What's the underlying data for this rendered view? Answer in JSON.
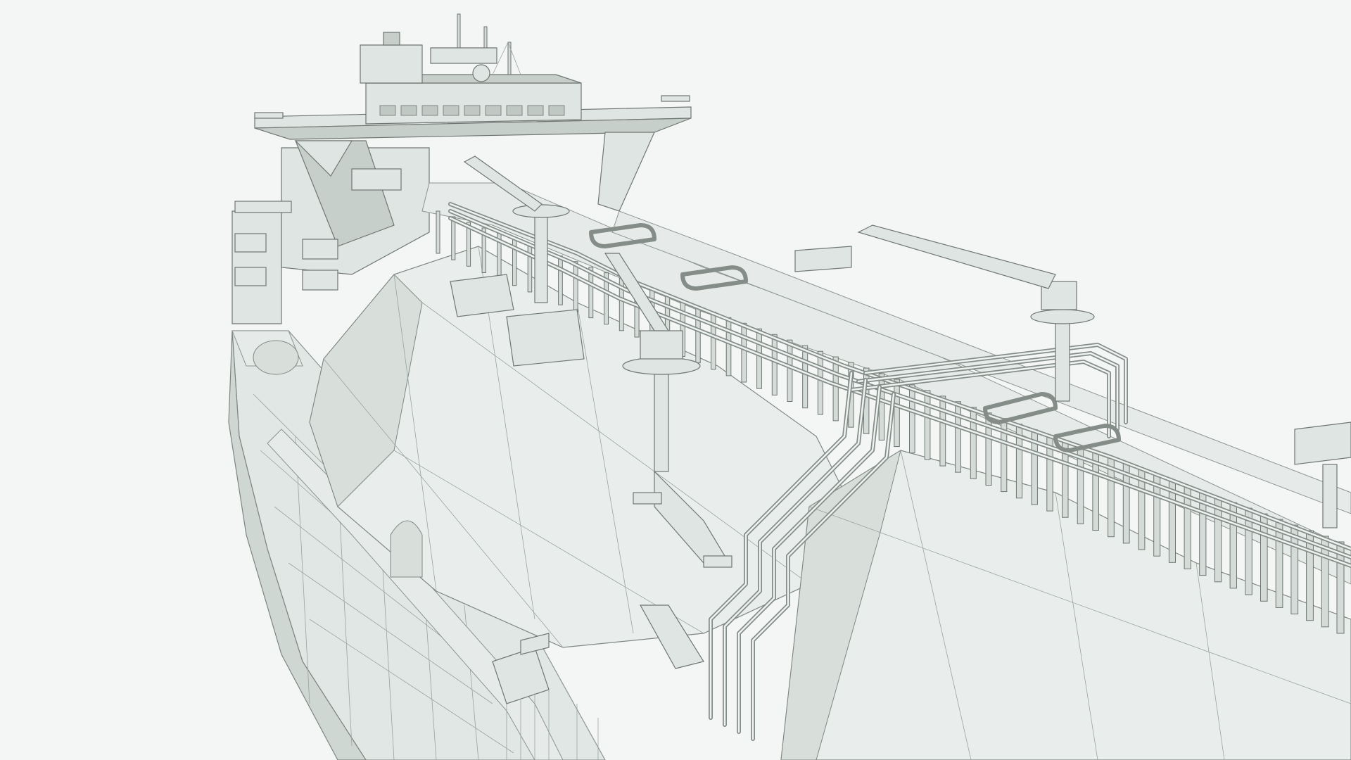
{
  "scene": {
    "subject": "",
    "background_color": "#f4f5f5",
    "model_color": "#e3e9e6",
    "line_color": "#7a827e"
  }
}
